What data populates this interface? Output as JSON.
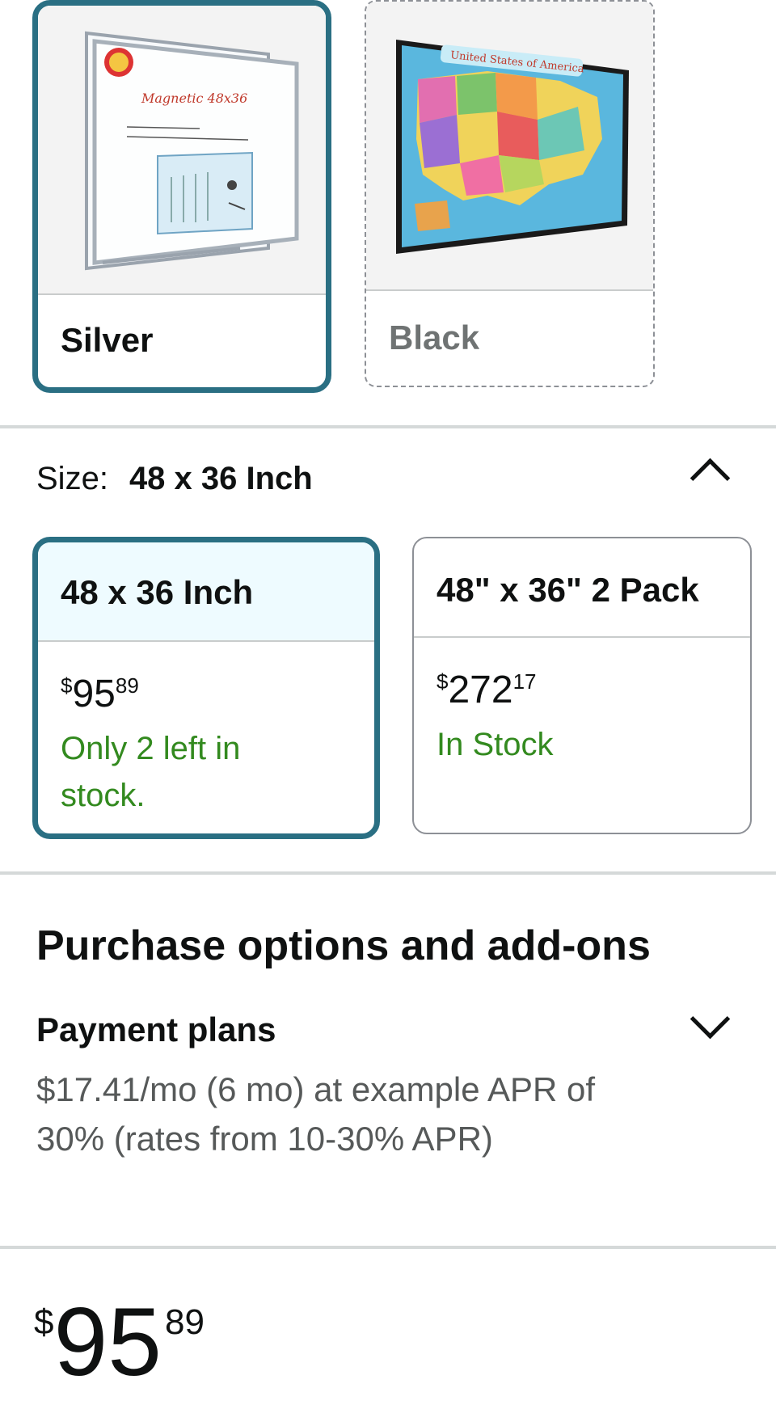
{
  "colors": {
    "accent_border": "#2a6f83",
    "stock_green": "#338a1f",
    "selected_header_bg": "#eefbff"
  },
  "color_options": [
    {
      "label": "Silver",
      "state": "selected",
      "image": "magnetic-whiteboard",
      "image_text": "Magnetic 48x36"
    },
    {
      "label": "Black",
      "state": "unavailable",
      "image": "united-states-map-board",
      "image_text": "United States of America"
    }
  ],
  "size": {
    "label": "Size:",
    "value": "48 x 36 Inch",
    "collapse_icon": "chevron-up-icon",
    "options": [
      {
        "name": "48 x 36 Inch",
        "currency": "$",
        "price_whole": "95",
        "price_cents": "89",
        "stock": "Only 2 left in stock.",
        "selected": true
      },
      {
        "name": "48\" x 36\" 2 Pack",
        "currency": "$",
        "price_whole": "272",
        "price_cents": "17",
        "stock": "In Stock",
        "selected": false
      }
    ]
  },
  "purchase": {
    "title": "Purchase options and add-ons",
    "payment_plans_title": "Payment plans",
    "payment_plans_text": "$17.41/mo (6 mo) at example APR of 30% (rates from 10-30% APR)",
    "expand_icon": "chevron-down-icon"
  },
  "price": {
    "currency": "$",
    "whole": "95",
    "cents": "89"
  }
}
